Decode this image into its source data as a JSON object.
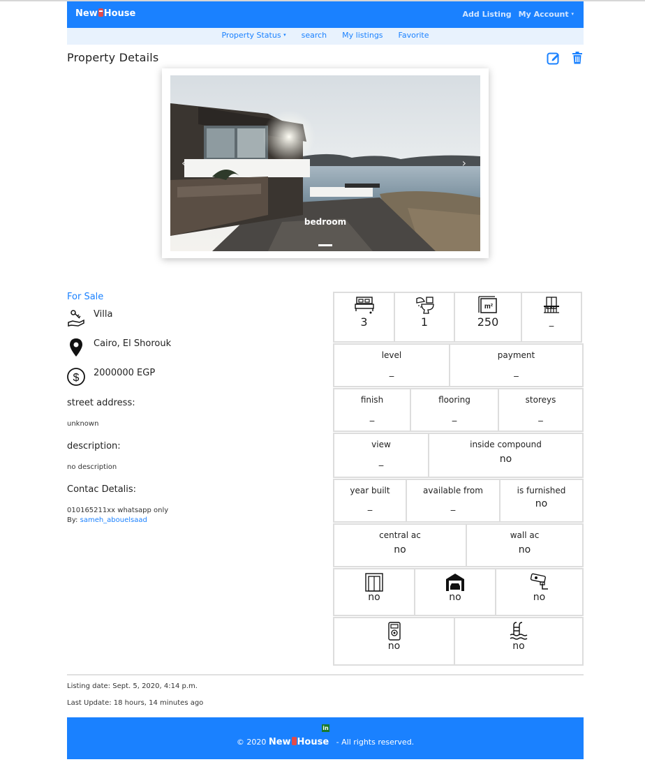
{
  "navbar": {
    "brand_left": "New",
    "brand_right": "House",
    "add_listing": "Add Listing",
    "my_account": "My Account",
    "caret": "▾"
  },
  "subnav": {
    "property_status": "Property Status",
    "search": "search",
    "my_listings": "My listings",
    "favorite": "Favorite",
    "caret": "▾"
  },
  "page_title": "Property Details",
  "carousel": {
    "caption": "bedroom",
    "prev": "‹",
    "next": "›"
  },
  "details": {
    "status": "For Sale",
    "type": "Villa",
    "location": "Cairo, El Shorouk",
    "price": "2000000 EGP",
    "street_label": "street address:",
    "street_value": "unknown",
    "description_label": "description:",
    "description_value": "no description",
    "contact_label": "Contac Detalis:",
    "contact_value": "010165211xx whatsapp only",
    "by_label": "By:",
    "by_user": "sameh_abouelsaad"
  },
  "features": {
    "bedrooms": "3",
    "bathrooms": "1",
    "area": "250",
    "balcony": "_",
    "level": {
      "label": "level",
      "value": "_"
    },
    "payment": {
      "label": "payment",
      "value": "_"
    },
    "finish": {
      "label": "finish",
      "value": "_"
    },
    "flooring": {
      "label": "flooring",
      "value": "_"
    },
    "storeys": {
      "label": "storeys",
      "value": "_"
    },
    "view": {
      "label": "view",
      "value": "_"
    },
    "inside_compound": {
      "label": "inside compound",
      "value": "no"
    },
    "year_built": {
      "label": "year built",
      "value": "_"
    },
    "available_from": {
      "label": "available from",
      "value": "_"
    },
    "is_furnished": {
      "label": "is furnished",
      "value": "no"
    },
    "central_ac": {
      "label": "central ac",
      "value": "no"
    },
    "wall_ac": {
      "label": "wall ac",
      "value": "no"
    },
    "elevator": "no",
    "garage": "no",
    "security_camera": "no",
    "intercom": "no",
    "pool": "no"
  },
  "meta": {
    "listing_date": "Listing date: Sept. 5, 2020, 4:14 p.m.",
    "last_update": "Last Update: 18 hours, 14 minutes ago"
  },
  "footer": {
    "linkedin": "in",
    "copy_prefix": "© 2020",
    "brand_left": "New",
    "brand_right": "House",
    "copy_suffix": "- All rights reserved."
  },
  "colors": {
    "primary": "#1a81ff",
    "subnav_bg": "#e8f2fd",
    "linkedin": "#1a7a2c"
  }
}
